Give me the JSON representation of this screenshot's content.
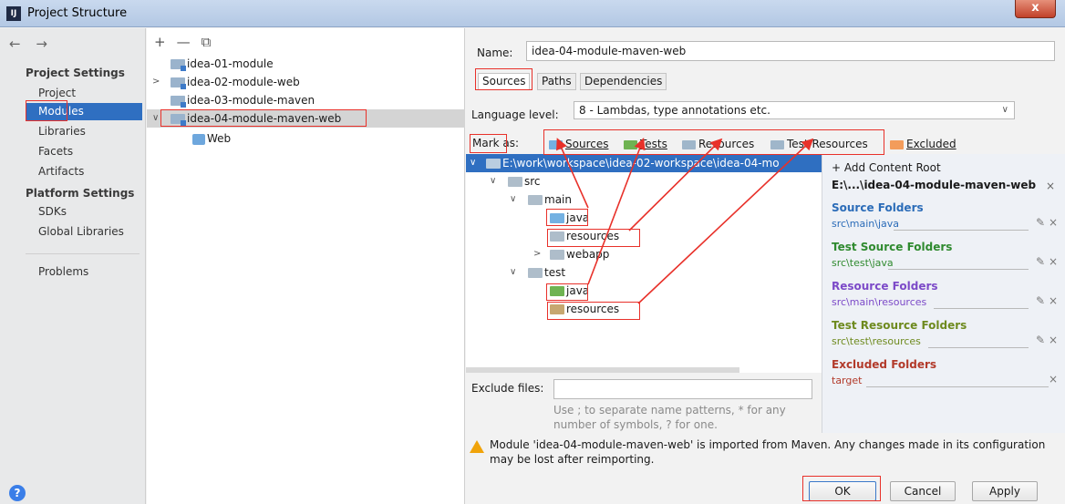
{
  "window": {
    "title": "Project Structure",
    "close_label": "x",
    "app_icon_text": "IJ"
  },
  "nav": {
    "arrows": "← →",
    "project_settings_heading": "Project Settings",
    "project_settings": [
      "Project",
      "Modules",
      "Libraries",
      "Facets",
      "Artifacts"
    ],
    "platform_settings_heading": "Platform Settings",
    "platform_settings": [
      "SDKs",
      "Global Libraries"
    ],
    "problems": "Problems",
    "selected": "Modules",
    "help_label": "?"
  },
  "modules": {
    "toolbar": [
      "+",
      "—",
      "⧉"
    ],
    "items": [
      {
        "label": "idea-01-module"
      },
      {
        "label": "idea-02-module-web"
      },
      {
        "label": "idea-03-module-maven"
      },
      {
        "label": "idea-04-module-maven-web"
      },
      {
        "label": "Web"
      }
    ]
  },
  "detail": {
    "name_label": "Name:",
    "name_value": "idea-04-module-maven-web",
    "tabs": [
      "Sources",
      "Paths",
      "Dependencies"
    ],
    "active_tab": "Sources",
    "language_level_label": "Language level:",
    "language_level_value": "8 - Lambdas, type annotations etc.",
    "mark_as_label": "Mark as:",
    "mark_as": [
      {
        "label": "Sources",
        "color": "#74b1e2"
      },
      {
        "label": "Tests",
        "color": "#6fb352"
      },
      {
        "label": "Resources",
        "color": "#9fb6ca"
      },
      {
        "label": "Test Resources",
        "color": "#9fb6ca"
      },
      {
        "label": "Excluded",
        "color": "#f39c5b"
      }
    ],
    "tree": [
      {
        "label": "E:\\work\\workspace\\idea-02-workspace\\idea-04-mo"
      },
      {
        "label": "src"
      },
      {
        "label": "main"
      },
      {
        "label": "java"
      },
      {
        "label": "resources"
      },
      {
        "label": "webapp"
      },
      {
        "label": "test"
      },
      {
        "label": "java"
      },
      {
        "label": "resources"
      }
    ],
    "exclude_files_label": "Exclude files:",
    "exclude_hint": "Use ; to separate name patterns, * for any number of symbols, ? for one.",
    "content_root": {
      "add_label": "+ Add Content Root",
      "root_path": "E:\\...\\idea-04-module-maven-web",
      "root_close": "×",
      "sections": [
        {
          "title": "Source Folders",
          "path": "src\\main\\java",
          "color": "#2b6cb8"
        },
        {
          "title": "Test Source Folders",
          "path": "src\\test\\java",
          "color": "#2f8a2f"
        },
        {
          "title": "Resource Folders",
          "path": "src\\main\\resources",
          "color": "#7c4ac8"
        },
        {
          "title": "Test Resource Folders",
          "path": "src\\test\\resources",
          "color": "#6e8a1e"
        },
        {
          "title": "Excluded Folders",
          "path": "target",
          "color": "#b23a2a"
        }
      ],
      "edit_glyph": "✎",
      "remove_glyph": "×"
    },
    "warning": "Module 'idea-04-module-maven-web' is imported from Maven. Any changes made in its configuration may be lost after reimporting.",
    "buttons": {
      "ok": "OK",
      "cancel": "Cancel",
      "apply": "Apply"
    }
  }
}
